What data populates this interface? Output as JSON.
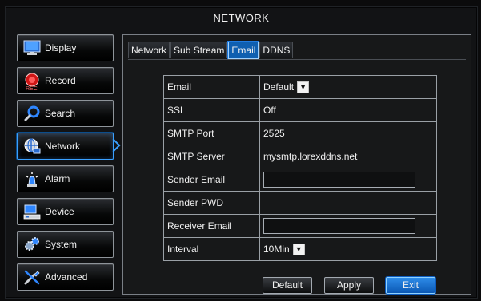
{
  "title": "NETWORK",
  "sidebar": {
    "items": [
      {
        "label": "Display",
        "icon": "display-icon",
        "active": false
      },
      {
        "label": "Record",
        "icon": "record-icon",
        "sub": "REC",
        "active": false
      },
      {
        "label": "Search",
        "icon": "search-icon",
        "active": false
      },
      {
        "label": "Network",
        "icon": "network-icon",
        "active": true
      },
      {
        "label": "Alarm",
        "icon": "alarm-icon",
        "active": false
      },
      {
        "label": "Device",
        "icon": "device-icon",
        "active": false
      },
      {
        "label": "System",
        "icon": "system-icon",
        "active": false
      },
      {
        "label": "Advanced",
        "icon": "advanced-icon",
        "active": false
      }
    ]
  },
  "tabs": [
    {
      "label": "Network",
      "active": false
    },
    {
      "label": "Sub Stream",
      "active": false
    },
    {
      "label": "Email",
      "active": true
    },
    {
      "label": "DDNS",
      "active": false
    }
  ],
  "form": {
    "email": {
      "label": "Email",
      "value": "Default"
    },
    "ssl": {
      "label": "SSL",
      "value": "Off"
    },
    "smtp_port": {
      "label": "SMTP Port",
      "value": "2525"
    },
    "smtp_server": {
      "label": "SMTP Server",
      "value": "mysmtp.lorexddns.net"
    },
    "sender_email": {
      "label": "Sender Email",
      "value": ""
    },
    "sender_pwd": {
      "label": "Sender PWD",
      "value": ""
    },
    "receiver_email": {
      "label": "Receiver Email",
      "value": ""
    },
    "interval": {
      "label": "Interval",
      "value": "10Min"
    }
  },
  "buttons": {
    "default": "Default",
    "apply": "Apply",
    "exit": "Exit"
  },
  "colors": {
    "accent": "#1f7be0",
    "panel_bg": "#171819",
    "border": "#9aa0a6"
  }
}
